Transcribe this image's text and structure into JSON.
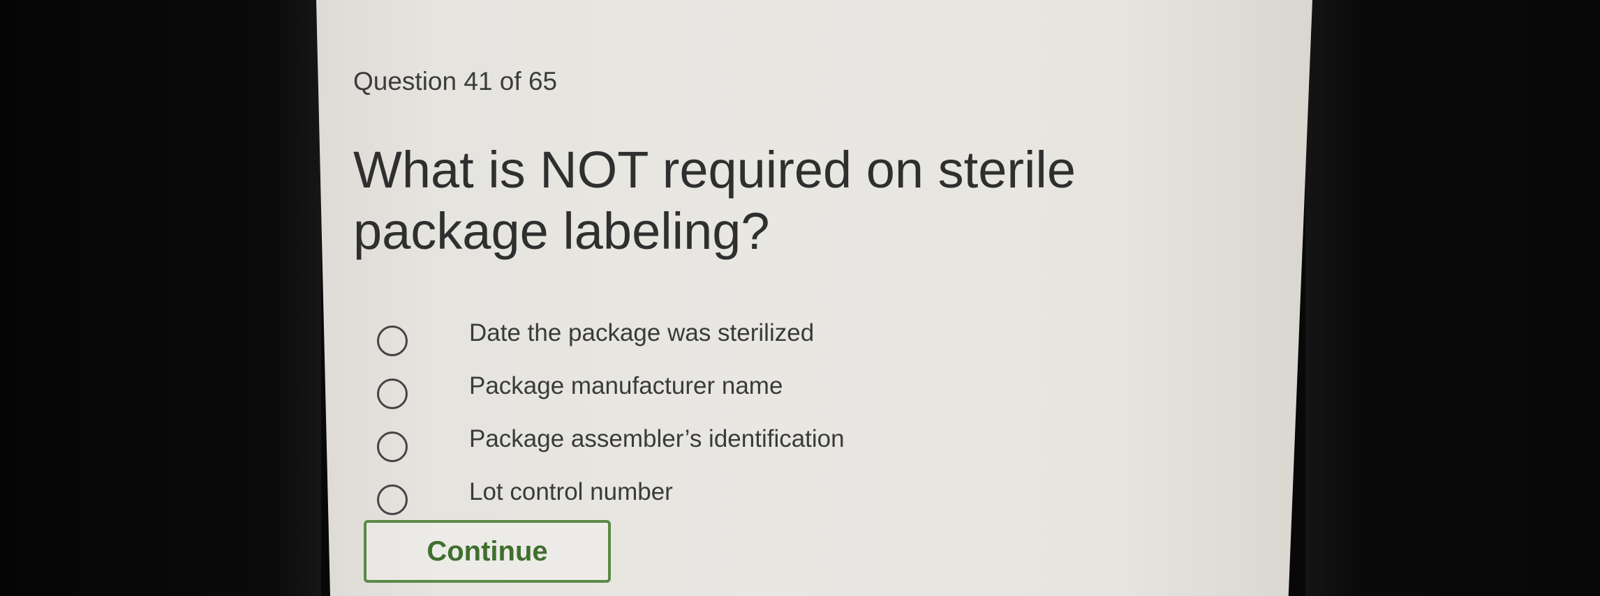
{
  "quiz": {
    "counter": "Question 41 of 65",
    "question": "What is NOT required on sterile package labeling?",
    "options": [
      "Date the package was sterilized",
      "Package manufacturer name",
      "Package assembler’s identification",
      "Lot control number"
    ],
    "continue_label": "Continue"
  },
  "colors": {
    "accent": "#5a8a47",
    "screen_background": "#e8e6e1",
    "bezel": "#080808"
  }
}
